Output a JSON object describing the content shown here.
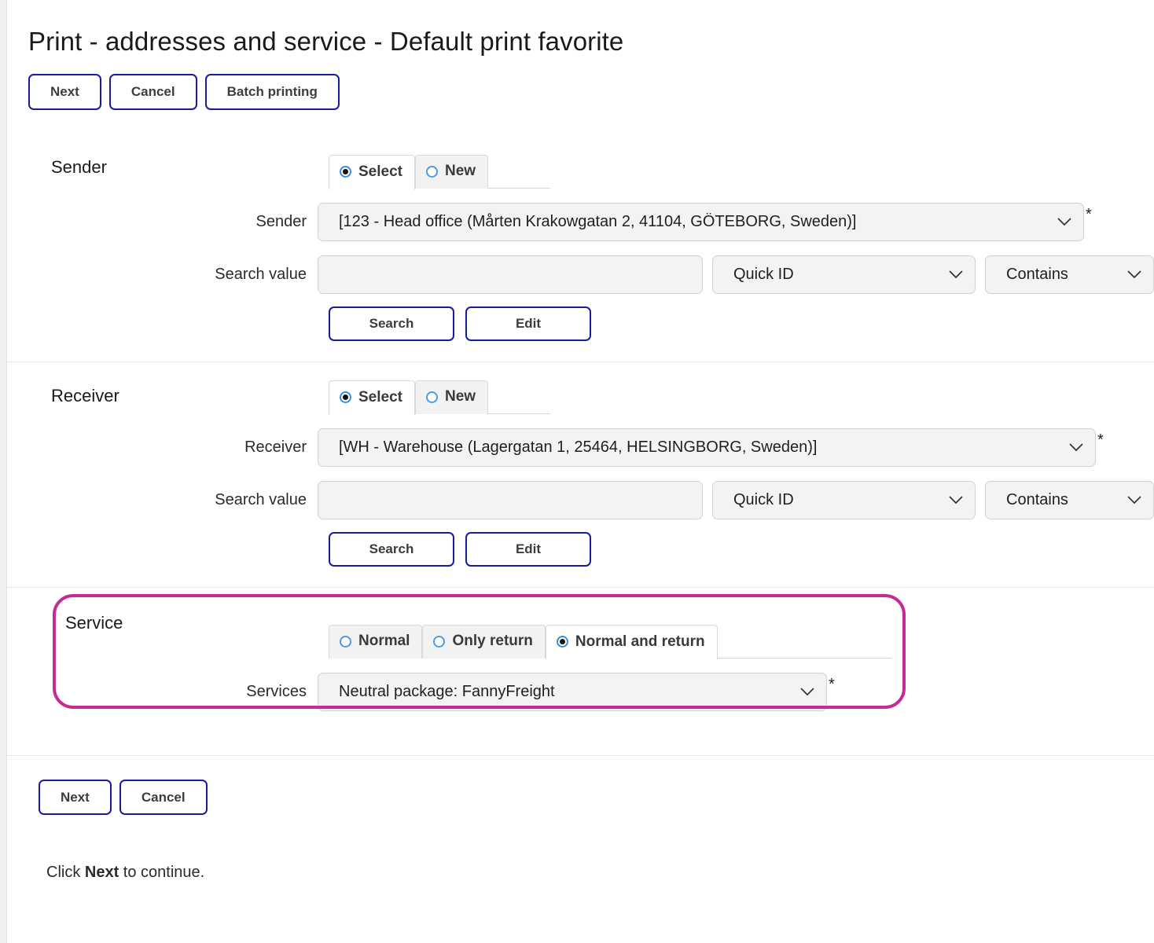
{
  "page": {
    "title": "Print - addresses and service  - Default print favorite"
  },
  "toolbar": {
    "next_label": "Next",
    "cancel_label": "Cancel",
    "batch_label": "Batch printing"
  },
  "sender": {
    "section_label": "Sender",
    "tabs": [
      {
        "label": "Select",
        "selected": true
      },
      {
        "label": "New",
        "selected": false
      }
    ],
    "sender_field_label": "Sender",
    "sender_value": "[123 - Head office (Mårten Krakowgatan 2, 41104, GÖTEBORG, Sweden)]",
    "required_mark": "*",
    "search_label": "Search value",
    "search_value": "",
    "search_placeholder": "",
    "quick_id_value": "Quick ID",
    "contains_value": "Contains",
    "search_button": "Search",
    "edit_button": "Edit"
  },
  "receiver": {
    "section_label": "Receiver",
    "tabs": [
      {
        "label": "Select",
        "selected": true
      },
      {
        "label": "New",
        "selected": false
      }
    ],
    "receiver_field_label": "Receiver",
    "receiver_value": "[WH - Warehouse (Lagergatan 1, 25464, HELSINGBORG, Sweden)]",
    "required_mark": "*",
    "search_label": "Search value",
    "search_value": "",
    "search_placeholder": "",
    "quick_id_value": "Quick ID",
    "contains_value": "Contains",
    "search_button": "Search",
    "edit_button": "Edit"
  },
  "service": {
    "section_label": "Service",
    "highlight_color": "#c72a95",
    "tabs": [
      {
        "label": "Normal",
        "selected": false
      },
      {
        "label": "Only return",
        "selected": false
      },
      {
        "label": "Normal and return",
        "selected": true
      }
    ],
    "services_field_label": "Services",
    "services_value": "Neutral package: FannyFreight",
    "required_mark": "*"
  },
  "footer": {
    "next_label": "Next",
    "cancel_label": "Cancel",
    "hint_prefix": "Click ",
    "hint_bold": "Next",
    "hint_suffix": " to continue."
  }
}
